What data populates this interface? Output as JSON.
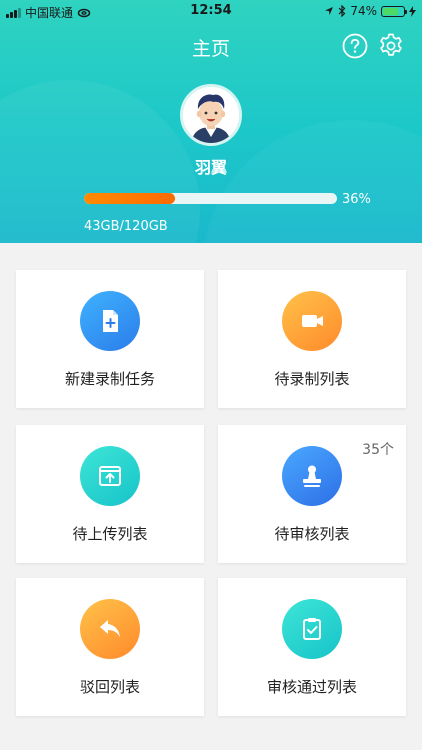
{
  "status_bar": {
    "carrier": "中国联通",
    "time": "12:54",
    "battery_percent": "74%",
    "battery_level": 0.74
  },
  "header": {
    "title": "主页",
    "help_icon": "question-circle-icon",
    "settings_icon": "gear-icon"
  },
  "profile": {
    "username": "羽翼",
    "storage_percent_label": "36%",
    "storage_progress": 0.36,
    "storage_text": "43GB/120GB"
  },
  "tiles": [
    {
      "label": "新建录制任务",
      "icon": "new-document-icon",
      "badge": ""
    },
    {
      "label": "待录制列表",
      "icon": "video-camera-icon",
      "badge": ""
    },
    {
      "label": "待上传列表",
      "icon": "upload-icon",
      "badge": ""
    },
    {
      "label": "待审核列表",
      "icon": "stamp-icon",
      "badge": "35个"
    },
    {
      "label": "驳回列表",
      "icon": "reply-arrow-icon",
      "badge": ""
    },
    {
      "label": "审核通过列表",
      "icon": "clipboard-check-icon",
      "badge": ""
    }
  ],
  "colors": {
    "header_gradient_start": "#2fd3c0",
    "header_gradient_end": "#1ab9cc",
    "progress_orange": "#ff7a00"
  }
}
